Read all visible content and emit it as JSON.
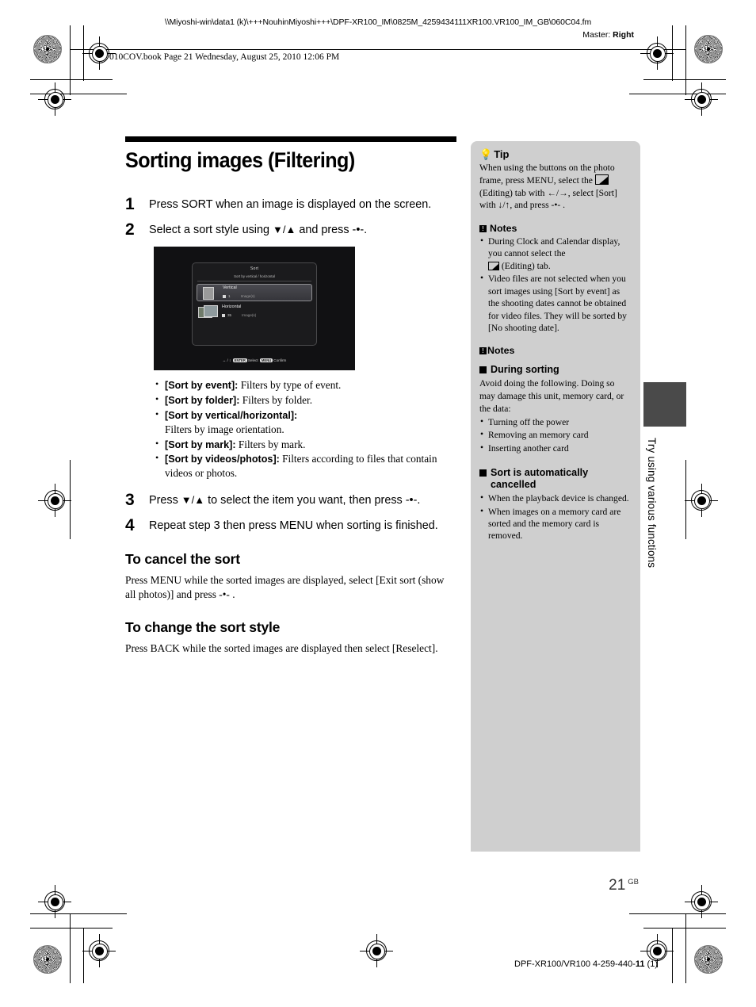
{
  "header": {
    "file_path": "\\\\Miyoshi-win\\data1 (k)\\+++NouhinMiyoshi+++\\DPF-XR100_IM\\0825M_4259434111XR100.VR100_IM_GB\\060C04.fm",
    "master_label": "Master:",
    "master_value": "Right",
    "book_line": "010COV.book  Page 21  Wednesday, August 25, 2010  12:06 PM"
  },
  "main": {
    "title": "Sorting images (Filtering)",
    "steps": [
      {
        "num": "1",
        "text": "Press SORT when an image is displayed on the screen."
      },
      {
        "num": "2",
        "text": "Select a sort style using ♦/♦ and press -•-."
      },
      {
        "num": "3",
        "text": "Press ♦/♦ to select the item you want, then press -•-."
      },
      {
        "num": "4",
        "text": "Repeat step 3 then press MENU when sorting is finished."
      }
    ],
    "step2_prefix": "Select a sort style using ",
    "step2_arrows": "↓/↑",
    "step2_suffix": " and press ",
    "step3_prefix": "Press ",
    "step3_arrows": "↓/↑",
    "step3_mid": " to select the item you want, then press ",
    "sort_options": [
      {
        "term": "[Sort by event]:",
        "desc": " Filters by type of event."
      },
      {
        "term": "[Sort by folder]:",
        "desc": " Filters by folder."
      },
      {
        "term": "[Sort by vertical/horizontal]:",
        "desc": "",
        "desc_next_line": "Filters by image orientation."
      },
      {
        "term": "[Sort by mark]:",
        "desc": " Filters by mark."
      },
      {
        "term": "[Sort by videos/photos]:",
        "desc": " Filters according to files that contain videos or photos."
      }
    ],
    "sections": [
      {
        "heading": "To cancel the sort",
        "body": "Press MENU while the sorted images are displayed, select [Exit sort (show all photos)] and press  -•- ."
      },
      {
        "heading": "To change the sort style",
        "body": "Press BACK while the sorted images are displayed then select [Reselect]."
      }
    ]
  },
  "lcd_screen": {
    "title": "Sort",
    "subtitle": "Sort by vertical / horizontal",
    "rows": [
      {
        "label": "Vertical",
        "count": "1",
        "unit": "Image(s)",
        "selected": true
      },
      {
        "label": "Horizontal",
        "count": "35",
        "unit": "Image(s)",
        "selected": false
      }
    ],
    "footer_nav": "↔ / ↕",
    "footer_key1": "ENTER",
    "footer_key1_label": "Select",
    "footer_key2": "MENU",
    "footer_key2_label": "Confirm"
  },
  "sidebar": {
    "tip": {
      "heading": "Tip",
      "text_part1": "When using the buttons on the photo frame, press MENU, select the ",
      "text_part2": " (Editing) tab with ←/→, select [Sort] with ↓/↑, and press  -•- ."
    },
    "notes1": {
      "heading": "Notes",
      "items": [
        "During Clock and Calendar display, you cannot select the",
        "Video files are not selected when you sort images using [Sort by event] as the shooting dates cannot be obtained for video files. They will be sorted by [No shooting date]."
      ],
      "item1_suffix": " (Editing) tab."
    },
    "notes2": {
      "heading": "Notes",
      "sub1_heading": "During sorting",
      "sub1_body": "Avoid doing the following. Doing so may damage this unit, memory card, or the data:",
      "sub1_items": [
        "Turning off the power",
        "Removing an memory card",
        "Inserting another card"
      ],
      "sub2_heading": "Sort is automatically cancelled",
      "sub2_items": [
        "When the playback device is changed.",
        "When images on a memory card are sorted and the memory card is removed."
      ]
    }
  },
  "side_tab": {
    "label": "Try using various functions"
  },
  "footer": {
    "page_number": "21",
    "page_suffix": "GB",
    "code_prefix": "DPF-XR100/VR100 4-259-440-",
    "code_bold": "11",
    "code_suffix": " (1)"
  },
  "colors": {
    "sidebar_bg": "#cfcfcf",
    "tab_block": "#4a4a4a",
    "lcd_bg": "#111113"
  }
}
